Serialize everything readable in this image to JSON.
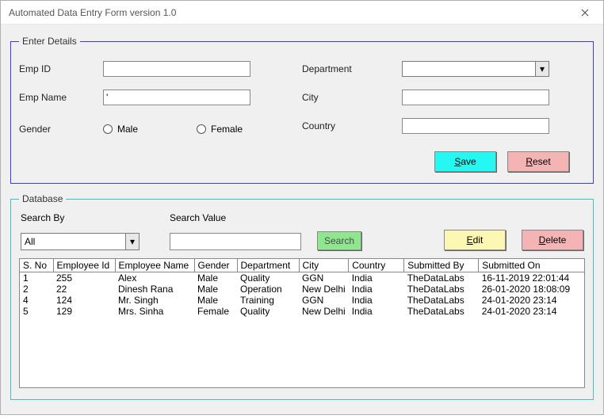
{
  "window": {
    "title": "Automated Data Entry Form version 1.0"
  },
  "details": {
    "legend": "Enter Details",
    "emp_id_label": "Emp ID",
    "emp_id_value": "",
    "emp_name_label": "Emp Name",
    "emp_name_value": "'",
    "gender_label": "Gender",
    "gender_male": "Male",
    "gender_female": "Female",
    "department_label": "Department",
    "department_value": "",
    "city_label": "City",
    "city_value": "",
    "country_label": "Country",
    "country_value": "",
    "save_label": "Save",
    "reset_label": "Reset"
  },
  "database": {
    "legend": "Database",
    "search_by_label": "Search By",
    "search_by_value": "All",
    "search_value_label": "Search Value",
    "search_value": "",
    "search_btn": "Search",
    "edit_btn": "Edit",
    "delete_btn": "Delete",
    "columns": {
      "sno": "S. No",
      "eid": "Employee Id",
      "name": "Employee Name",
      "gender": "Gender",
      "dept": "Department",
      "city": "City",
      "country": "Country",
      "sby": "Submitted By",
      "son": "Submitted On"
    },
    "rows": [
      {
        "sno": "1",
        "eid": "255",
        "name": "Alex",
        "gender": "Male",
        "dept": "Quality",
        "city": "GGN",
        "country": "India",
        "sby": "TheDataLabs",
        "son": "16-11-2019 22:01:44"
      },
      {
        "sno": "2",
        "eid": "22",
        "name": "Dinesh Rana",
        "gender": "Male",
        "dept": "Operation",
        "city": "New Delhi",
        "country": "India",
        "sby": "TheDataLabs",
        "son": "26-01-2020 18:08:09"
      },
      {
        "sno": "4",
        "eid": "124",
        "name": "Mr. Singh",
        "gender": "Male",
        "dept": "Training",
        "city": "GGN",
        "country": "India",
        "sby": "TheDataLabs",
        "son": "24-01-2020 23:14"
      },
      {
        "sno": "5",
        "eid": "129",
        "name": "Mrs. Sinha",
        "gender": "Female",
        "dept": "Quality",
        "city": "New Delhi",
        "country": "India",
        "sby": "TheDataLabs",
        "son": "24-01-2020 23:14"
      }
    ]
  }
}
